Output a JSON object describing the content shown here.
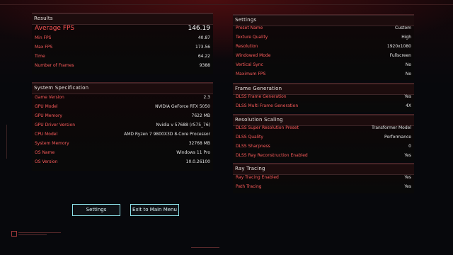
{
  "results": {
    "title": "Results",
    "rows": [
      {
        "label": "Average FPS",
        "value": "146.19"
      },
      {
        "label": "Min FPS",
        "value": "40.87"
      },
      {
        "label": "Max FPS",
        "value": "173.56"
      },
      {
        "label": "Time",
        "value": "64.22"
      },
      {
        "label": "Number of Frames",
        "value": "9388"
      }
    ]
  },
  "system": {
    "title": "System Specification",
    "rows": [
      {
        "label": "Game Version",
        "value": "2.3"
      },
      {
        "label": "GPU Model",
        "value": "NVIDIA GeForce RTX 5050"
      },
      {
        "label": "GPU Memory",
        "value": "7622 MB"
      },
      {
        "label": "GPU Driver Version",
        "value": "Nvidia v 57688 (r575_76)"
      },
      {
        "label": "CPU Model",
        "value": "AMD Ryzen 7 9800X3D 8-Core Processor"
      },
      {
        "label": "System Memory",
        "value": "32768 MB"
      },
      {
        "label": "OS Name",
        "value": "Windows 11 Pro"
      },
      {
        "label": "OS Version",
        "value": "10.0.26100"
      }
    ]
  },
  "settings": {
    "title": "Settings",
    "rows": [
      {
        "label": "Preset Name",
        "value": "Custom"
      },
      {
        "label": "Texture Quality",
        "value": "High"
      },
      {
        "label": "Resolution",
        "value": "1920x1080"
      },
      {
        "label": "Windowed Mode",
        "value": "Fullscreen"
      },
      {
        "label": "Vertical Sync",
        "value": "No"
      },
      {
        "label": "Maximum FPS",
        "value": "No"
      }
    ]
  },
  "frame_generation": {
    "title": "Frame Generation",
    "rows": [
      {
        "label": "DLSS Frame Generation",
        "value": "Yes"
      },
      {
        "label": "DLSS Multi Frame Generation",
        "value": "4X"
      }
    ]
  },
  "resolution_scaling": {
    "title": "Resolution Scaling",
    "rows": [
      {
        "label": "DLSS Super Resolution Preset",
        "value": "Transformer Model"
      },
      {
        "label": "DLSS Quality",
        "value": "Performance"
      },
      {
        "label": "DLSS Sharpness",
        "value": "0"
      },
      {
        "label": "DLSS Ray Reconstruction Enabled",
        "value": "Yes"
      }
    ]
  },
  "ray_tracing": {
    "title": "Ray Tracing",
    "rows": [
      {
        "label": "Ray Tracing Enabled",
        "value": "Yes"
      },
      {
        "label": "Path Tracing",
        "value": "Yes"
      }
    ]
  },
  "buttons": {
    "settings": "Settings",
    "exit": "Exit to Main Menu"
  },
  "colors": {
    "label_red": "#ff5c5c",
    "button_border_cyan": "#8fe3ec",
    "background": "#07080c"
  }
}
